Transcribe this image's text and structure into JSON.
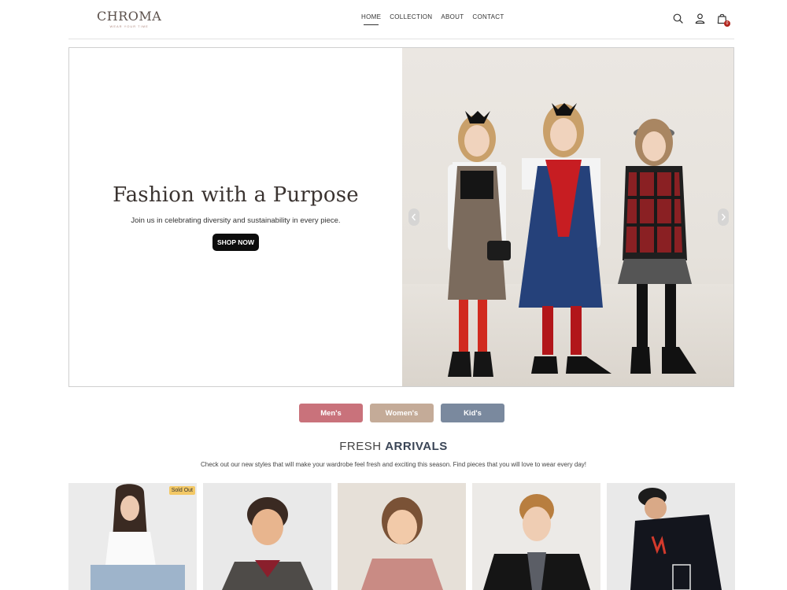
{
  "brand": {
    "name": "CHROMA",
    "tagline": "WEAR YOUR TIME"
  },
  "nav": [
    {
      "label": "HOME",
      "active": true
    },
    {
      "label": "COLLECTION",
      "active": false
    },
    {
      "label": "ABOUT",
      "active": false
    },
    {
      "label": "CONTACT",
      "active": false
    }
  ],
  "header_icons": [
    "search-icon",
    "user-icon",
    "shopping-bag-icon"
  ],
  "cart": {
    "count": "0"
  },
  "hero": {
    "title": "Fashion with a Purpose",
    "subtitle": "Join us in celebrating diversity and sustainability in every piece.",
    "cta": "SHOP NOW",
    "prev_icon": "chevron-left-icon",
    "next_icon": "chevron-right-icon"
  },
  "categories": [
    {
      "label": "Men's",
      "color": "#c9727b"
    },
    {
      "label": "Women's",
      "color": "#c4ab98"
    },
    {
      "label": "Kid's",
      "color": "#7a899e"
    }
  ],
  "fresh": {
    "title_light": "FRESH",
    "title_bold": "ARRIVALS",
    "description": "Check out our new styles that will make your wardrobe feel fresh and exciting this season. Find pieces that you will love to wear every day!"
  },
  "products": [
    {
      "badge": "Sold Out"
    },
    {
      "badge": ""
    },
    {
      "badge": ""
    },
    {
      "badge": ""
    },
    {
      "badge": ""
    }
  ]
}
